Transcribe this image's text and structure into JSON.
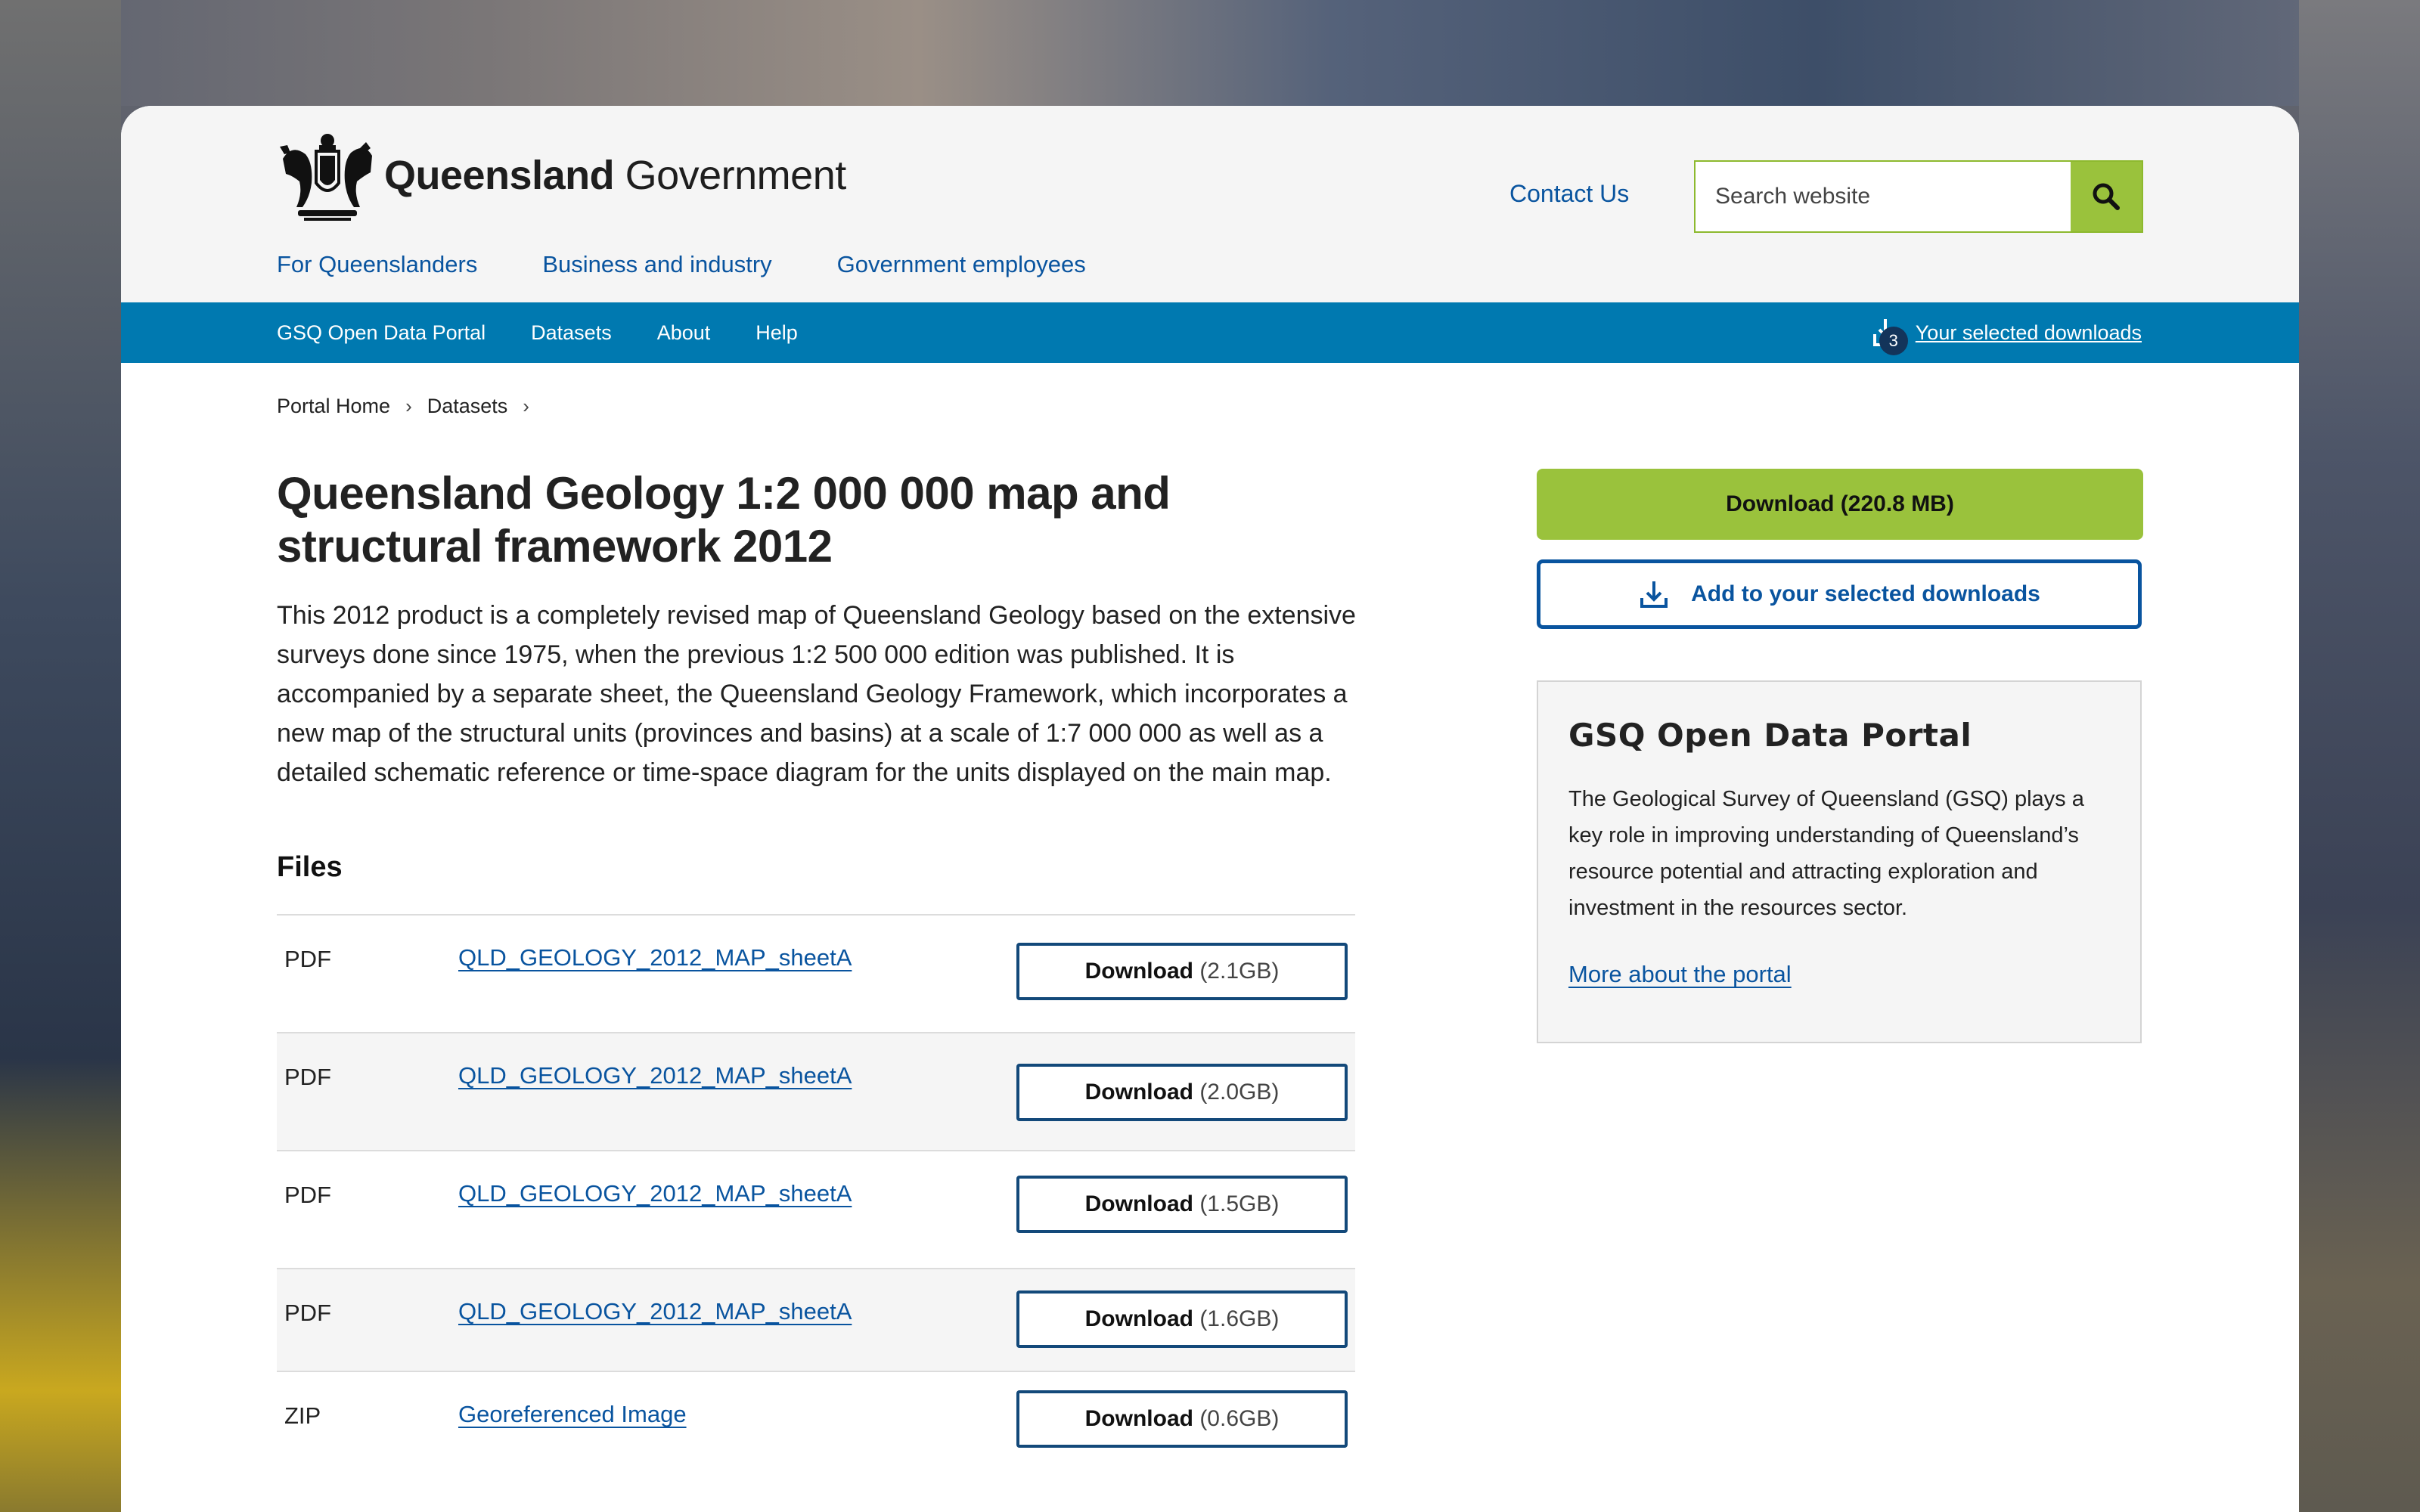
{
  "header": {
    "logo_bold": "Queensland",
    "logo_light": "Government",
    "contact_label": "Contact Us",
    "search_placeholder": "Search website",
    "nav": [
      "For Queenslanders",
      "Business and industry",
      "Government employees"
    ]
  },
  "subnav": {
    "items": [
      "GSQ Open Data Portal",
      "Datasets",
      "About",
      "Help"
    ],
    "selected_count": "3",
    "selected_label": "Your selected downloads"
  },
  "breadcrumb": [
    "Portal Home",
    "Datasets"
  ],
  "main": {
    "title": "Queensland Geology 1:2 000 000 map and structural framework 2012",
    "description": "This 2012 product is a completely revised map of Queensland Geology based on the extensive surveys done since 1975, when the previous 1:2 500 000 edition was published. It is accompanied by a separate sheet, the Queensland Geology Framework, which incorporates a new map of the structural units (provinces and basins) at a scale of 1:7 000 000 as well as a detailed schematic reference or time-space diagram for the units displayed on the main map.",
    "files_heading": "Files",
    "download_word": "Download",
    "files": [
      {
        "type": "PDF",
        "name": "QLD_GEOLOGY_2012_MAP_sheetA",
        "size": "(2.1GB)"
      },
      {
        "type": "PDF",
        "name": "QLD_GEOLOGY_2012_MAP_sheetA",
        "size": "(2.0GB)"
      },
      {
        "type": "PDF",
        "name": "QLD_GEOLOGY_2012_MAP_sheetA",
        "size": "(1.5GB)"
      },
      {
        "type": "PDF",
        "name": "QLD_GEOLOGY_2012_MAP_sheetA",
        "size": "(1.6GB)"
      },
      {
        "type": "ZIP",
        "name": "Georeferenced Image",
        "size": "(0.6GB)"
      }
    ]
  },
  "sidebar": {
    "download_all": "Download (220.8 MB)",
    "add_selected": "Add to your selected downloads",
    "box_title": "GSQ Open Data Portal",
    "box_text": "The Geological Survey of Queensland (GSQ) plays a key role in improving understanding of Queensland’s resource potential and attracting exploration and investment in the resources sector.",
    "box_link": "More about the portal"
  },
  "colors": {
    "brand_blue": "#0079b0",
    "link_blue": "#09549f",
    "accent_green": "#9ac23c"
  }
}
